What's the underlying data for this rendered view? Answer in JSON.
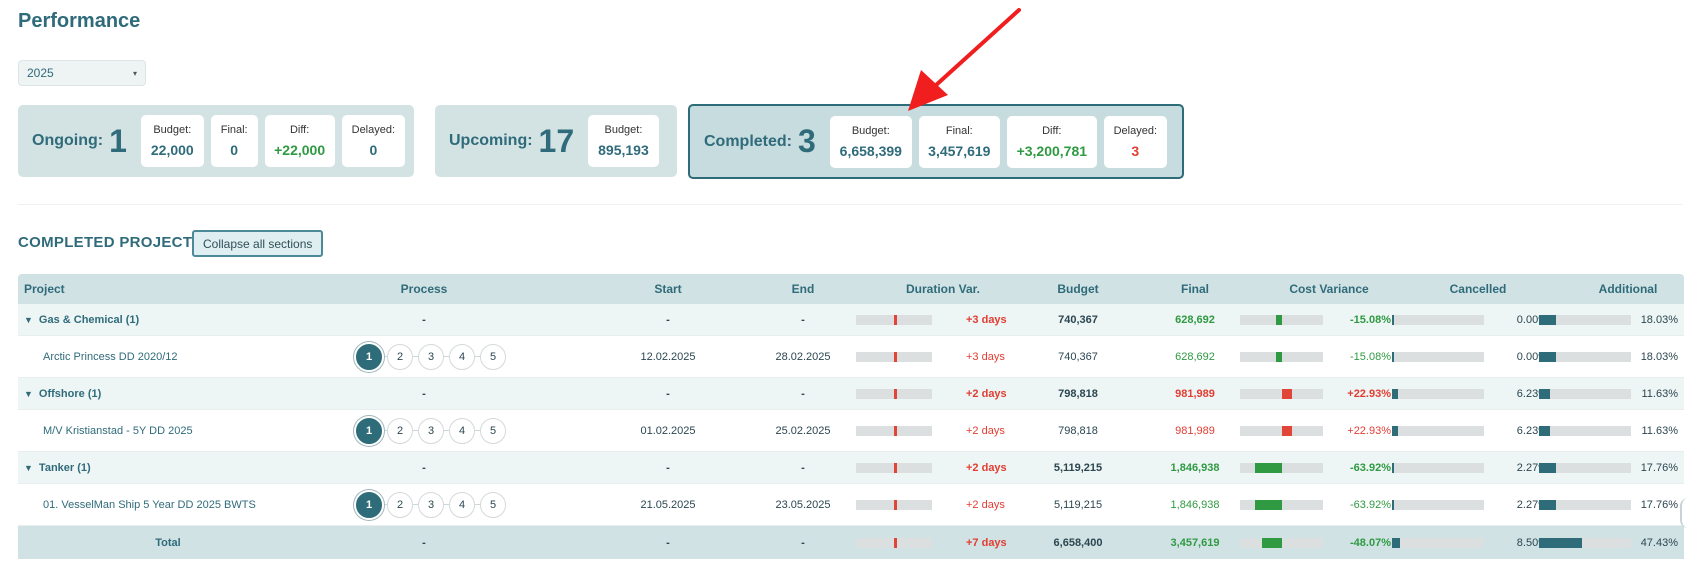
{
  "page": {
    "title": "Performance"
  },
  "filter": {
    "year": "2025"
  },
  "summary": {
    "ongoing": {
      "label": "Ongoing:",
      "count": "1",
      "stats": [
        {
          "k": "Budget:",
          "v": "22,000"
        },
        {
          "k": "Final:",
          "v": "0"
        },
        {
          "k": "Diff:",
          "v": "+22,000"
        },
        {
          "k": "Delayed:",
          "v": "0"
        }
      ]
    },
    "upcoming": {
      "label": "Upcoming:",
      "count": "17",
      "stats": [
        {
          "k": "Budget:",
          "v": "895,193"
        }
      ]
    },
    "completed": {
      "label": "Completed:",
      "count": "3",
      "stats": [
        {
          "k": "Budget:",
          "v": "6,658,399"
        },
        {
          "k": "Final:",
          "v": "3,457,619"
        },
        {
          "k": "Diff:",
          "v": "+3,200,781"
        },
        {
          "k": "Delayed:",
          "v": "3"
        }
      ]
    }
  },
  "section": {
    "title": "COMPLETED PROJECTS",
    "collapse_label": "Collapse all sections"
  },
  "table": {
    "headers": [
      "Project",
      "Process",
      "Start",
      "End",
      "Duration Var.",
      "Budget",
      "Final",
      "Cost Variance",
      "Cancelled",
      "Additional"
    ],
    "process_steps": [
      "1",
      "2",
      "3",
      "4",
      "5"
    ],
    "groups": [
      {
        "name": "Gas & Chemical (1)",
        "start": "-",
        "end": "-",
        "process": "-",
        "duration": "+3 days",
        "duration_pos": 0.5,
        "budget": "740,367",
        "final": "628,692",
        "cost_var": "-15.08%",
        "cost_var_frac": 0.15,
        "cancelled": "0.00%",
        "cancelled_frac": 0.0,
        "additional": "18.03%",
        "additional_frac": 0.18,
        "project": {
          "name": "Arctic Princess DD 2020/12",
          "start": "12.02.2025",
          "end": "28.02.2025",
          "active_step": 1,
          "duration": "+3 days",
          "budget": "740,367",
          "final": "628,692",
          "cost_var": "-15.08%",
          "cancelled": "0.00%",
          "additional": "18.03%"
        }
      },
      {
        "name": "Offshore (1)",
        "start": "-",
        "end": "-",
        "process": "-",
        "duration": "+2 days",
        "duration_pos": 0.5,
        "budget": "798,818",
        "final": "981,989",
        "cost_var": "+22.93%",
        "cost_var_frac": 0.23,
        "cancelled": "6.23%",
        "cancelled_frac": 0.06,
        "additional": "11.63%",
        "additional_frac": 0.12,
        "project": {
          "name": "M/V Kristianstad - 5Y DD 2025",
          "start": "01.02.2025",
          "end": "25.02.2025",
          "active_step": 1,
          "duration": "+2 days",
          "budget": "798,818",
          "final": "981,989",
          "cost_var": "+22.93%",
          "cancelled": "6.23%",
          "additional": "11.63%"
        }
      },
      {
        "name": "Tanker (1)",
        "start": "-",
        "end": "-",
        "process": "-",
        "duration": "+2 days",
        "duration_pos": 0.5,
        "budget": "5,119,215",
        "final": "1,846,938",
        "cost_var": "-63.92%",
        "cost_var_frac": 0.64,
        "cancelled": "2.27%",
        "cancelled_frac": 0.02,
        "additional": "17.76%",
        "additional_frac": 0.18,
        "project": {
          "name": "01. VesselMan Ship 5 Year DD 2025 BWTS",
          "start": "21.05.2025",
          "end": "23.05.2025",
          "active_step": 1,
          "duration": "+2 days",
          "budget": "5,119,215",
          "final": "1,846,938",
          "cost_var": "-63.92%",
          "cancelled": "2.27%",
          "additional": "17.76%"
        }
      }
    ],
    "total": {
      "label": "Total",
      "process": "-",
      "start": "-",
      "end": "-",
      "duration": "+7 days",
      "budget": "6,658,400",
      "final": "3,457,619",
      "cost_var": "-48.07%",
      "cost_var_frac": 0.48,
      "cancelled": "8.50%",
      "cancelled_frac": 0.085,
      "additional": "47.43%",
      "additional_frac": 0.47
    }
  },
  "colors": {
    "accent": "#2e6c7a",
    "positive": "#2f9a42",
    "negative": "#e23d32",
    "header_bg": "#d0e2e4"
  }
}
